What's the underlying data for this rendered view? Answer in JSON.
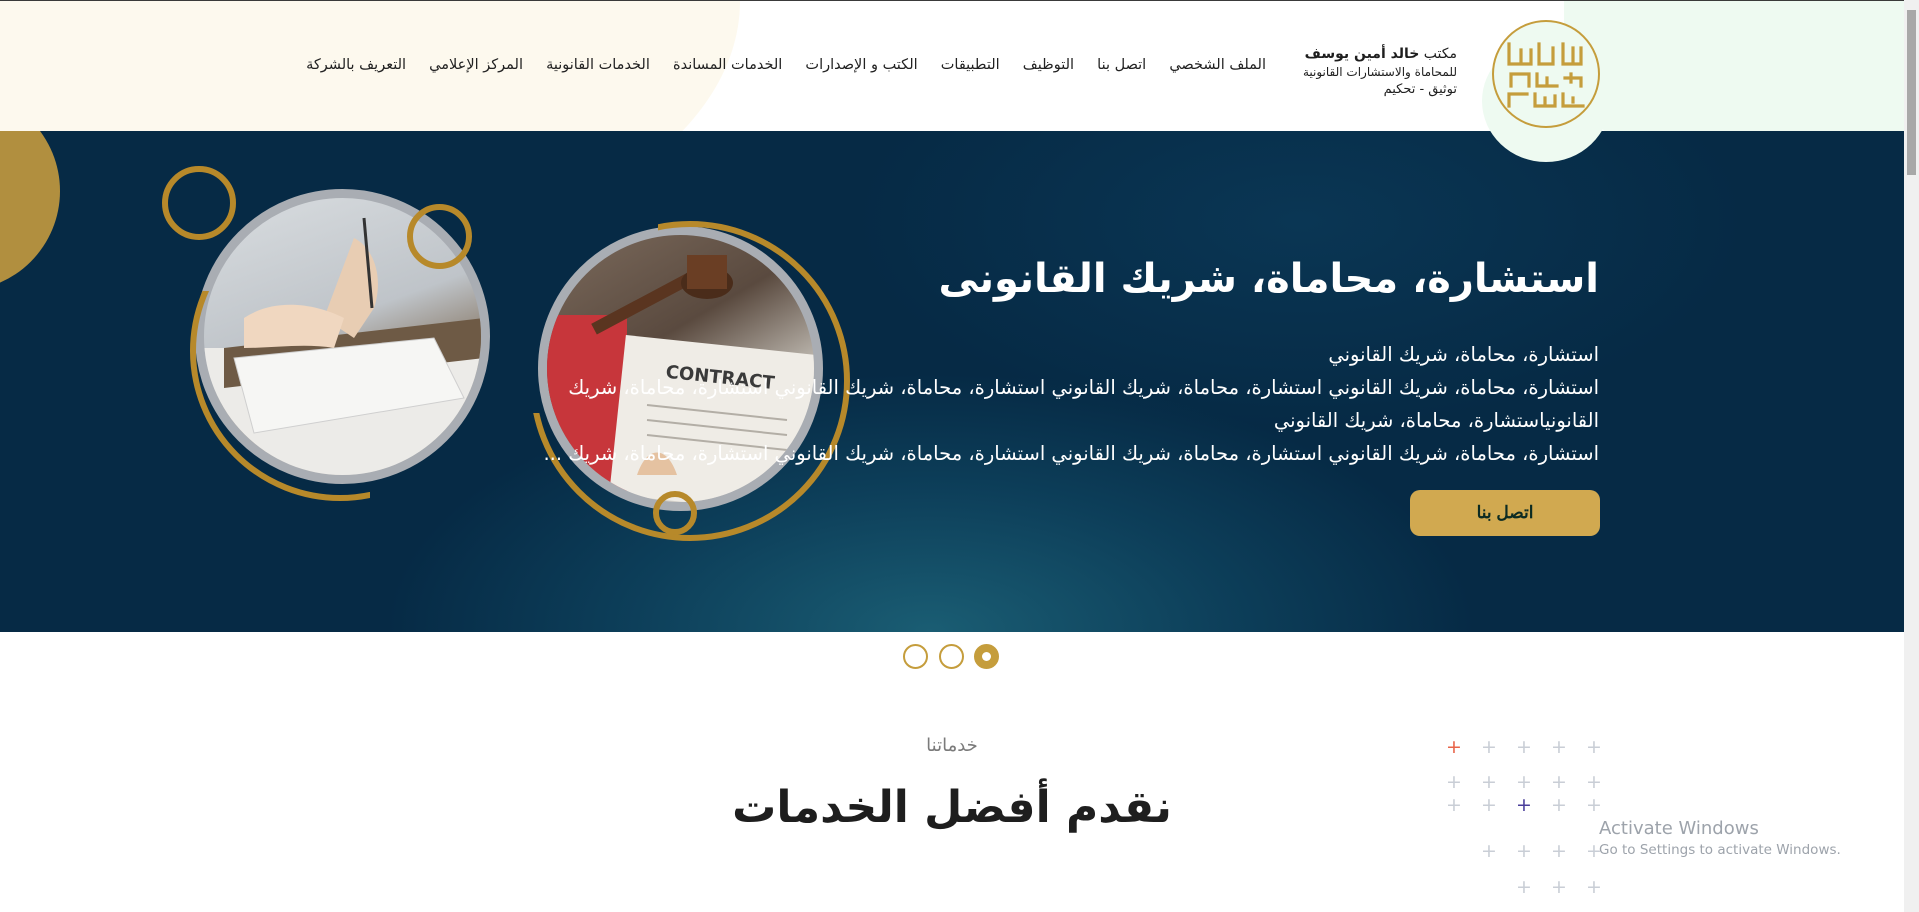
{
  "brand": {
    "line1_prefix": "مكتب",
    "line1_name": "خالد أمين يوسف",
    "line2": "للمحاماة والاستشارات القانونية",
    "line3": "توثيق - تحكيم",
    "logo_text": "يوسف أمين خالد",
    "accent_color": "#c59d3c"
  },
  "nav": {
    "items": [
      "التعريف بالشركة",
      "المركز الإعلامي",
      "الخدمات القانونية",
      "الخدمات المساندة",
      "الكتب و الإصدارات",
      "التطبيقات",
      "التوظيف",
      "اتصل بنا",
      "الملف الشخصي"
    ]
  },
  "hero": {
    "title": "استشارة، محاماة، شريك القانونى",
    "lines": [
      "استشارة، محاماة، شريك القانوني",
      "استشارة، محاماة، شريك القانوني استشارة، محاماة، شريك القانوني استشارة، محاماة، شريك القانوني استشارة، محاماة، شريك",
      "القانونياستشارة، محاماة، شريك القانوني",
      "استشارة، محاماة، شريك القانوني استشارة، محاماة، شريك القانوني استشارة، محاماة، شريك القانوني استشارة، محاماة، شريك ..."
    ],
    "cta_label": "اتصل بنا",
    "background_color": "#062a45"
  },
  "slider": {
    "count": 3,
    "active_index": 2
  },
  "services": {
    "subtitle": "خدماتنا",
    "title": "نقدم أفضل الخدمات"
  },
  "watermark": {
    "line1": "Activate Windows",
    "line2": "Go to Settings to activate Windows."
  }
}
